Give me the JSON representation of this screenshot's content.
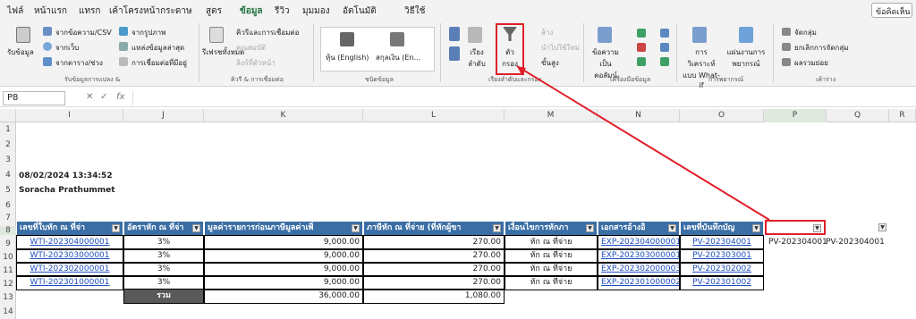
{
  "tabs": [
    "ไฟล์",
    "หน้าแรก",
    "แทรก",
    "เค้าโครงหน้ากระดาษ",
    "สูตร",
    "ข้อมูล",
    "รีวิว",
    "มุมมอง",
    "อัตโนมัติ",
    "วิธีใช้"
  ],
  "comment_label": "ข้อคิดเห็น",
  "ribbon": {
    "get_data": "รับข้อมูล",
    "from_text": "จากข้อความ/CSV",
    "from_web": "จากเว็บ",
    "from_table": "จากตาราง/ช่วง",
    "from_picture": "จากรูปภาพ",
    "recent_sources": "แหล่งข้อมูลล่าสุด",
    "existing_conn": "การเชื่อมต่อที่มีอยู่",
    "group1": "รับข้อมูลการแปลง &",
    "refresh_all": "รีเฟรชทั้งหมด",
    "queries_conn": "คิวรีและการเชื่อมต่อ",
    "properties": "คุณสมบัติ",
    "edit_links": "ลิงก์ที่ตัวหน้า",
    "group2": "คิวรี & การเชื่อมต่อ",
    "stock1": "หุ้น (English)",
    "stock2": "สกุลเงิน (En...",
    "group3": "ชนิดข้อมูล",
    "sort": "เรียงลำดับ",
    "filter": "ตัวกรอง",
    "clear": "ล้าง",
    "reapply": "นำไปใช้ใหม่",
    "advanced": "ขั้นสูง",
    "group4": "เรียงลำดับและกรอง",
    "text_to_col": "ข้อความเป็นคอลัมน์",
    "group5": "เครื่องมือข้อมูล",
    "whatif": "การวิเคราะห์แบบ What-if",
    "forecast": "แผ่นงานการพยากรณ์",
    "group6": "การพยากรณ์",
    "group_btn": "จัดกลุ่ม",
    "ungroup_btn": "ยกเลิกการจัดกลุ่ม",
    "subtotal": "ผลรวมย่อย",
    "group7": "เค้าร่าง"
  },
  "name_box": "P8",
  "fx": "fx",
  "columns": [
    "I",
    "J",
    "K",
    "L",
    "M",
    "N",
    "O",
    "P",
    "Q",
    "R"
  ],
  "rows": [
    "1",
    "2",
    "3",
    "4",
    "5",
    "6",
    "7",
    "8",
    "9",
    "10",
    "11",
    "12",
    "13",
    "14"
  ],
  "r4": "08/02/2024 13:34:52",
  "r5": "Soracha Prathummet",
  "headers": [
    "เลขที่ใบหัก ณ ที่จ่า",
    "อัตราหัก ณ ที่จ่า",
    "มูลค่ารายการก่อนภาษีมูลค่าเพิ่",
    "ภาษีหัก ณ ที่จ่าย (ที่หักผู้ขา",
    "เงื่อนไขการหักภา",
    "เอกสารอ้างอิ",
    "เลขที่บันทึกบัญ"
  ],
  "data": [
    [
      "WTI-202304000001",
      "3%",
      "9,000.00",
      "270.00",
      "หัก ณ ที่จ่าย",
      "EXP-202304000001",
      "PV-202304001"
    ],
    [
      "WTI-202303000001",
      "3%",
      "9,000.00",
      "270.00",
      "หัก ณ ที่จ่าย",
      "EXP-202303000001",
      "PV-202303001"
    ],
    [
      "WTI-202302000001",
      "3%",
      "9,000.00",
      "270.00",
      "หัก ณ ที่จ่าย",
      "EXP-202302000003",
      "PV-202302002"
    ],
    [
      "WTI-202301000001",
      "3%",
      "9,000.00",
      "270.00",
      "หัก ณ ที่จ่าย",
      "EXP-202301000002",
      "PV-202301002"
    ]
  ],
  "total_label": "รวม",
  "total_k": "36,000.00",
  "total_l": "1,080.00",
  "p9": "PV-202304001",
  "q9": "PV-202304001",
  "accent": "#e0202a"
}
